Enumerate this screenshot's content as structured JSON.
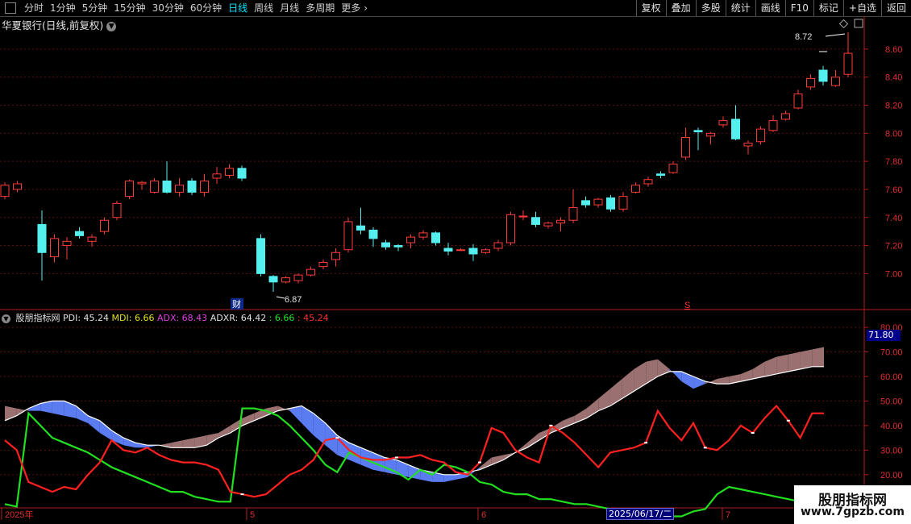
{
  "toolbar": {
    "periods": [
      "分时",
      "1分钟",
      "5分钟",
      "15分钟",
      "30分钟",
      "60分钟",
      "日线",
      "周线",
      "月线",
      "多周期",
      "更多"
    ],
    "active_period": "日线",
    "right_buttons": [
      "复权",
      "叠加",
      "多股",
      "统计",
      "画线",
      "F10",
      "标记",
      "+自选",
      "返回"
    ]
  },
  "stock": {
    "title": "华夏银行(日线,前复权)"
  },
  "price_axis": {
    "labels": [
      "8.60",
      "8.40",
      "8.20",
      "8.00",
      "7.80",
      "7.60",
      "7.40",
      "7.20",
      "7.00"
    ],
    "min": 6.87,
    "max": 8.72
  },
  "annotations": {
    "high": "8.72",
    "low": "6.87",
    "cai_marker": "财",
    "s_marker": "S"
  },
  "indicator": {
    "name": "股朋指标网",
    "pdi_label": "PDI: 45.24",
    "mdi_label": "MDI: 6.66",
    "adx_label": "ADX: 68.43",
    "adxr_label": "ADXR: 64.42",
    "extra1": ": 6.66",
    "extra2": ": 45.24",
    "axis_labels": [
      "80.00",
      "70.00",
      "60.00",
      "50.00",
      "40.00",
      "30.00",
      "20.00"
    ],
    "current_value": "71.80"
  },
  "time_axis": {
    "labels": [
      "2025年",
      "5",
      "6",
      "7"
    ],
    "cursor_date": "2025/06/17/二"
  },
  "watermark": {
    "title": "股朋指标网",
    "url": "www.7gpzb.com"
  },
  "colors": {
    "up": "#ff3b3b",
    "down": "#54f0f0",
    "pdi": "#ff2020",
    "mdi": "#20e020",
    "adx_up": "#9a7070",
    "adx_down": "#5a7cf0",
    "adx_line": "#ffffff"
  },
  "chart_data": [
    {
      "type": "candlestick",
      "title": "华夏银行(日线,前复权)",
      "ylim": [
        6.87,
        8.72
      ],
      "candles": [
        [
          7.55,
          7.63,
          7.65,
          7.53
        ],
        [
          7.6,
          7.64,
          7.66,
          7.58
        ],
        [
          7.35,
          7.15,
          7.45,
          6.95
        ],
        [
          7.12,
          7.25,
          7.28,
          7.08
        ],
        [
          7.2,
          7.23,
          7.26,
          7.1
        ],
        [
          7.3,
          7.27,
          7.33,
          7.25
        ],
        [
          7.23,
          7.26,
          7.28,
          7.19
        ],
        [
          7.3,
          7.38,
          7.4,
          7.28
        ],
        [
          7.4,
          7.5,
          7.52,
          7.38
        ],
        [
          7.55,
          7.66,
          7.67,
          7.53
        ],
        [
          7.64,
          7.65,
          7.66,
          7.6
        ],
        [
          7.58,
          7.66,
          7.68,
          7.57
        ],
        [
          7.66,
          7.58,
          7.8,
          7.57
        ],
        [
          7.58,
          7.63,
          7.68,
          7.55
        ],
        [
          7.66,
          7.58,
          7.68,
          7.56
        ],
        [
          7.58,
          7.66,
          7.71,
          7.55
        ],
        [
          7.68,
          7.71,
          7.76,
          7.64
        ],
        [
          7.7,
          7.75,
          7.78,
          7.68
        ],
        [
          7.75,
          7.68,
          7.77,
          7.66
        ],
        [
          7.25,
          7.0,
          7.28,
          6.98
        ],
        [
          6.98,
          6.94,
          6.99,
          6.87
        ],
        [
          6.94,
          6.97,
          6.98,
          6.93
        ],
        [
          6.95,
          6.99,
          7.0,
          6.93
        ],
        [
          6.99,
          7.03,
          7.05,
          6.98
        ],
        [
          7.05,
          7.08,
          7.1,
          7.03
        ],
        [
          7.1,
          7.15,
          7.18,
          7.05
        ],
        [
          7.17,
          7.37,
          7.4,
          7.15
        ],
        [
          7.34,
          7.31,
          7.47,
          7.28
        ],
        [
          7.31,
          7.25,
          7.33,
          7.19
        ],
        [
          7.22,
          7.19,
          7.24,
          7.17
        ],
        [
          7.2,
          7.19,
          7.21,
          7.16
        ],
        [
          7.22,
          7.26,
          7.28,
          7.18
        ],
        [
          7.26,
          7.29,
          7.31,
          7.24
        ],
        [
          7.29,
          7.22,
          7.3,
          7.2
        ],
        [
          7.18,
          7.16,
          7.22,
          7.13
        ],
        [
          7.17,
          7.17,
          7.18,
          7.16
        ],
        [
          7.18,
          7.14,
          7.21,
          7.09
        ],
        [
          7.15,
          7.17,
          7.18,
          7.14
        ],
        [
          7.18,
          7.22,
          7.24,
          7.16
        ],
        [
          7.22,
          7.42,
          7.44,
          7.2
        ],
        [
          7.41,
          7.41,
          7.45,
          7.38
        ],
        [
          7.4,
          7.35,
          7.44,
          7.33
        ],
        [
          7.34,
          7.36,
          7.37,
          7.32
        ],
        [
          7.36,
          7.38,
          7.4,
          7.3
        ],
        [
          7.38,
          7.47,
          7.6,
          7.36
        ],
        [
          7.52,
          7.49,
          7.55,
          7.47
        ],
        [
          7.49,
          7.53,
          7.54,
          7.47
        ],
        [
          7.54,
          7.46,
          7.56,
          7.44
        ],
        [
          7.46,
          7.55,
          7.58,
          7.44
        ],
        [
          7.58,
          7.63,
          7.65,
          7.57
        ],
        [
          7.64,
          7.67,
          7.69,
          7.62
        ],
        [
          7.71,
          7.7,
          7.73,
          7.68
        ],
        [
          7.72,
          7.78,
          7.8,
          7.71
        ],
        [
          7.83,
          7.97,
          8.04,
          7.81
        ],
        [
          8.02,
          8.01,
          8.04,
          7.88
        ],
        [
          7.98,
          8.0,
          8.01,
          7.92
        ],
        [
          8.06,
          8.09,
          8.12,
          8.04
        ],
        [
          8.1,
          7.96,
          8.2,
          7.95
        ],
        [
          7.91,
          7.93,
          7.95,
          7.85
        ],
        [
          7.94,
          8.03,
          8.05,
          7.92
        ],
        [
          8.02,
          8.09,
          8.13,
          8.01
        ],
        [
          8.1,
          8.14,
          8.16,
          8.09
        ],
        [
          8.18,
          8.28,
          8.31,
          8.17
        ],
        [
          8.33,
          8.39,
          8.42,
          8.31
        ],
        [
          8.45,
          8.37,
          8.48,
          8.34
        ],
        [
          8.34,
          8.4,
          8.45,
          8.33
        ],
        [
          8.42,
          8.57,
          8.72,
          8.4
        ]
      ]
    },
    {
      "type": "line",
      "ylim": [
        15,
        82
      ],
      "series": [
        {
          "name": "PDI",
          "values": [
            34,
            30,
            17,
            15,
            13,
            15,
            14,
            20,
            25,
            34,
            30,
            29,
            31,
            28,
            26,
            25,
            25,
            24,
            22,
            13,
            12,
            11,
            12,
            16,
            20,
            22,
            26,
            34,
            35,
            30,
            27,
            26,
            26,
            27,
            27,
            28,
            26,
            25,
            21,
            20,
            25,
            39,
            37,
            30,
            27,
            25,
            40,
            37,
            33,
            28,
            23,
            29,
            30,
            31,
            33,
            46,
            39,
            34,
            41,
            31,
            30,
            34,
            40,
            37,
            43,
            48,
            42,
            35,
            45,
            45
          ]
        },
        {
          "name": "MDI",
          "values": [
            8,
            7,
            45,
            40,
            35,
            33,
            31,
            29,
            26,
            23,
            21,
            19,
            17,
            15,
            13,
            13,
            11,
            10,
            9,
            9,
            47,
            47,
            46,
            44,
            40,
            35,
            30,
            24,
            21,
            29,
            27,
            25,
            23,
            21,
            18,
            22,
            20,
            24,
            23,
            21,
            17,
            16,
            13,
            12,
            12,
            10,
            10,
            9,
            8,
            8,
            7,
            6,
            5,
            4,
            4,
            4,
            3,
            3,
            5,
            6,
            12,
            15,
            14,
            13,
            12,
            11,
            10,
            9,
            10,
            9
          ]
        },
        {
          "name": "ADX",
          "values": [
            48,
            47,
            46,
            46,
            45,
            44,
            43,
            41,
            37,
            34,
            32,
            31,
            31,
            32,
            33,
            34,
            35,
            36,
            37,
            40,
            43,
            45,
            47,
            48,
            46,
            41,
            36,
            32,
            28,
            26,
            24,
            22,
            21,
            20,
            19,
            18,
            17,
            17,
            18,
            19,
            23,
            27,
            28,
            29,
            33,
            37,
            39,
            42,
            44,
            47,
            51,
            55,
            59,
            63,
            66,
            67,
            63,
            58,
            55,
            57,
            59,
            60,
            61,
            63,
            66,
            68,
            69,
            70,
            71,
            72
          ]
        },
        {
          "name": "ADXR",
          "values": [
            42,
            44,
            47,
            49,
            50,
            50,
            48,
            44,
            42,
            38,
            35,
            33,
            32,
            32,
            31,
            31,
            31,
            32,
            35,
            37,
            40,
            42,
            44,
            46,
            47,
            48,
            45,
            41,
            36,
            33,
            31,
            29,
            27,
            26,
            24,
            22,
            21,
            20,
            20,
            21,
            22,
            24,
            26,
            29,
            31,
            34,
            37,
            39,
            41,
            43,
            46,
            48,
            51,
            54,
            57,
            60,
            62,
            62,
            60,
            58,
            57,
            57,
            58,
            59,
            60,
            61,
            62,
            63,
            64,
            64
          ]
        }
      ]
    }
  ]
}
